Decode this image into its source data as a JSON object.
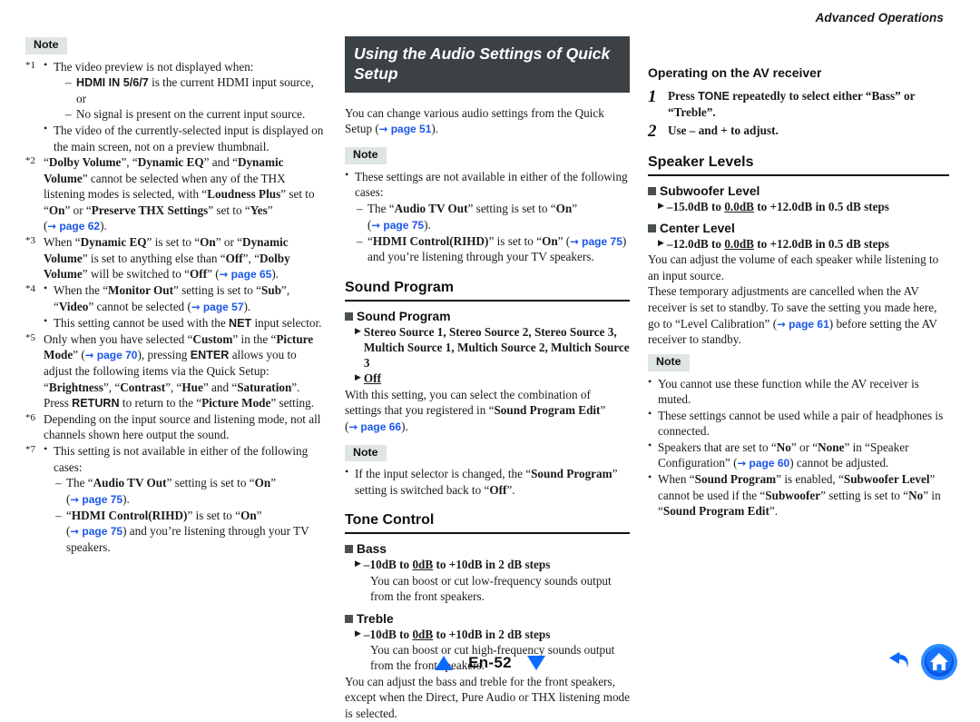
{
  "running_header": "Advanced Operations",
  "colors": {
    "link": "#1a56e8",
    "title_bar_bg": "#3b4144",
    "note_badge_bg": "#dfe6e2",
    "square_bullet": "#4a4f52",
    "nav_blue": "#0a6bff"
  },
  "footer": {
    "page_label": "En-52",
    "prev_icon": "triangle-up-icon",
    "next_icon": "triangle-down-icon",
    "back_icon": "back-arrow-icon",
    "home_icon": "home-icon"
  },
  "left_column": {
    "note_badge": "Note",
    "footnotes": [
      {
        "mark": "*1",
        "bullets": [
          {
            "text": "The video preview is not displayed when:",
            "subitems": [
              {
                "pre": "",
                "bold": "HDMI IN 5/6/7",
                "post": " is the current HDMI input source, or",
                "bold_sans": true
              },
              {
                "pre": "No signal is present on the current input source.",
                "bold": "",
                "post": "",
                "bold_sans": false
              }
            ]
          },
          {
            "text": "The video of the currently-selected input is displayed on the main screen, not on a preview thumbnail.",
            "subitems": []
          }
        ]
      },
      {
        "mark": "*2",
        "html": "“<b>Dolby Volume</b>”, “<b>Dynamic EQ</b>” and “<b>Dynamic Volume</b>” cannot be selected when any of the THX listening modes is selected, with “<b>Loudness Plus</b>” set to “<b>On</b>” or “<b>Preserve THX Settings</b>” set to “<b>Yes</b>” (PAGELINK:62)."
      },
      {
        "mark": "*3",
        "html": "When “<b>Dynamic EQ</b>” is set to “<b>On</b>” or “<b>Dynamic Volume</b>” is set to anything else than “<b>Off</b>”, “<b>Dolby Volume</b>” will be switched to “<b>Off</b>” (PAGELINK:65)."
      },
      {
        "mark": "*4",
        "bullets_html": [
          "When the “<b>Monitor Out</b>” setting is set to “<b>Sub</b>”, “<b>Video</b>” cannot be selected (PAGELINK:57).",
          "This setting cannot be used with the <span class=\"key\">NET</span> input selector."
        ]
      },
      {
        "mark": "*5",
        "html": "Only when you have selected “<b>Custom</b>” in the “<b>Picture Mode</b>” (PAGELINK:70), pressing <span class=\"key\">ENTER</span> allows you to adjust the following items via the Quick Setup: “<b>Brightness</b>”, “<b>Contrast</b>”, “<b>Hue</b>” and “<b>Saturation</b>”. Press <span class=\"key\">RETURN</span> to return to the “<b>Picture Mode</b>” setting."
      },
      {
        "mark": "*6",
        "html": "Depending on the input source and listening mode, not all channels shown here output the sound."
      },
      {
        "mark": "*7",
        "bullets_html": [
          "This setting is not available in either of the following cases:"
        ],
        "dashes_html": [
          "The “<b>Audio TV Out</b>” setting is set to “<b>On</b>” (PAGELINK:75).",
          "“<b>HDMI Control(RIHD)</b>” is set to “<b>On</b>” (PAGELINK:75) and you’re listening through your TV speakers."
        ]
      }
    ]
  },
  "middle_column": {
    "title": "Using the Audio Settings of Quick Setup",
    "intro_html": "You can change various audio settings from the Quick Setup (PAGELINK:51).",
    "note_badge": "Note",
    "note_bullets_html": [
      "These settings are not available in either of the following cases:"
    ],
    "note_dashes_html": [
      "The “<b>Audio TV Out</b>” setting is set to “<b>On</b>” (PAGELINK:75).",
      "“<b>HDMI Control(RIHD)</b>” is set to “<b>On</b>” (PAGELINK:75) and you’re listening through your TV speakers."
    ],
    "sections": [
      {
        "heading": "Sound Program",
        "subheading": "Sound Program",
        "values_html": [
          "<b>Stereo Source 1</b>, <b>Stereo Source 2</b>, <b>Stereo Source 3</b>, <b>Multich Source 1</b>, <b>Multich Source 2</b>, <b>Multich Source 3</b>",
          "<b class=\"ul\">Off</b>"
        ],
        "body_html": "With this setting, you can select the combination of settings that you registered in “<b>Sound Program Edit</b>” (PAGELINK:66).",
        "note_badge": "Note",
        "note_bullets_html": [
          "If the input selector is changed, the “<b>Sound Program</b>” setting is switched back to “<b>Off</b>”."
        ]
      },
      {
        "heading": "Tone Control",
        "items": [
          {
            "subheading": "Bass",
            "value_html": "<b>–10dB</b> to <b class=\"ul\">0dB</b> to <b>+10dB</b> in 2 dB steps",
            "desc": "You can boost or cut low-frequency sounds output from the front speakers."
          },
          {
            "subheading": "Treble",
            "value_html": "<b>–10dB</b> to <b class=\"ul\">0dB</b> to <b>+10dB</b> in 2 dB steps",
            "desc": "You can boost or cut high-frequency sounds output from the front speakers."
          }
        ],
        "body": "You can adjust the bass and treble for the front speakers, except when the Direct, Pure Audio or THX listening mode is selected."
      }
    ]
  },
  "right_column": {
    "operating_heading": "Operating on the AV receiver",
    "steps": [
      {
        "num": "1",
        "html": "Press <span class=\"key\">TONE</span> repeatedly to select either “Bass” or “Treble”."
      },
      {
        "num": "2",
        "html": "Use – and + to adjust."
      }
    ],
    "section": {
      "heading": "Speaker Levels",
      "items": [
        {
          "subheading": "Subwoofer Level",
          "value_html": "<b>–15.0dB</b> to <b class=\"ul\">0.0dB</b> to <b>+12.0dB</b> in 0.5 dB steps"
        },
        {
          "subheading": "Center Level",
          "value_html": "<b>–12.0dB</b> to <b class=\"ul\">0.0dB</b> to <b>+12.0dB</b> in 0.5 dB steps"
        }
      ],
      "body_paras_html": [
        "You can adjust the volume of each speaker while listening to an input source.",
        "These temporary adjustments are cancelled when the AV receiver is set to standby. To save the setting you made here, go to “Level Calibration” (PAGELINK:61) before setting the AV receiver to standby."
      ],
      "note_badge": "Note",
      "note_bullets_html": [
        "You cannot use these function while the AV receiver is muted.",
        "These settings cannot be used while a pair of headphones is connected.",
        "Speakers that are set to “<b>No</b>” or “<b>None</b>” in “Speaker Configuration” (PAGELINK:60) cannot be adjusted.",
        "When “<b>Sound Program</b>” is enabled, “<b>Subwoofer Level</b>” cannot be used if the “<b>Subwoofer</b>” setting is set to “<b>No</b>” in “<b>Sound Program Edit</b>”."
      ]
    }
  }
}
